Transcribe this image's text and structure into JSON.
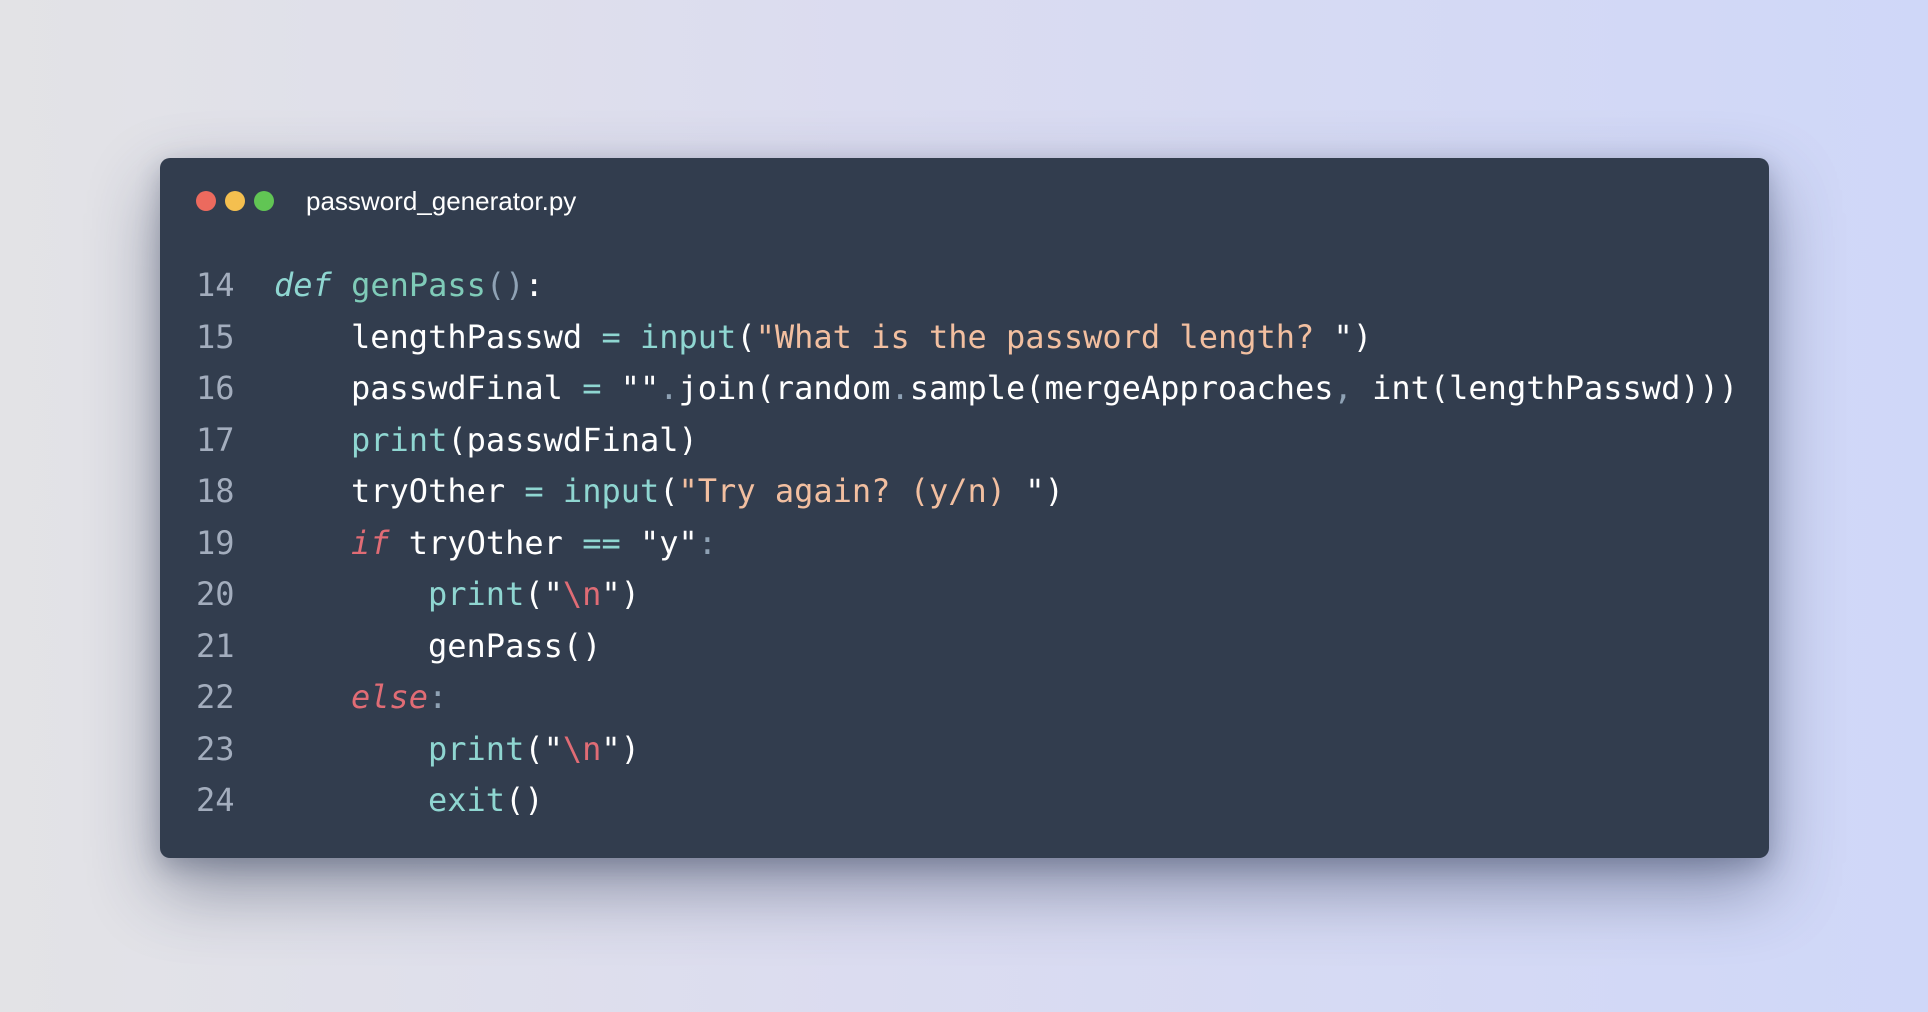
{
  "window": {
    "filename": "password_generator.py",
    "colors": {
      "background": "#323d4e",
      "close": "#ec6a5e",
      "minimize": "#f4bf4f",
      "maximize": "#61c554"
    }
  },
  "code": {
    "language": "python",
    "lines": [
      {
        "number": "14",
        "indent": 0,
        "tokens": [
          {
            "t": "def",
            "c": "def"
          },
          {
            "t": " ",
            "c": "id"
          },
          {
            "t": "genPass",
            "c": "fn"
          },
          {
            "t": "()",
            "c": "dim"
          },
          {
            "t": ":",
            "c": "id"
          }
        ]
      },
      {
        "number": "15",
        "indent": 1,
        "tokens": [
          {
            "t": "lengthPasswd",
            "c": "id"
          },
          {
            "t": " ",
            "c": "id"
          },
          {
            "t": "=",
            "c": "op"
          },
          {
            "t": " ",
            "c": "id"
          },
          {
            "t": "input",
            "c": "bi"
          },
          {
            "t": "(",
            "c": "id"
          },
          {
            "t": "\"What is the password length? ",
            "c": "str"
          },
          {
            "t": "\")",
            "c": "id"
          }
        ]
      },
      {
        "number": "16",
        "indent": 1,
        "tokens": [
          {
            "t": "passwdFinal",
            "c": "id"
          },
          {
            "t": " ",
            "c": "id"
          },
          {
            "t": "=",
            "c": "op"
          },
          {
            "t": " ",
            "c": "id"
          },
          {
            "t": "\"\"",
            "c": "id"
          },
          {
            "t": ".",
            "c": "dim"
          },
          {
            "t": "join(random",
            "c": "id"
          },
          {
            "t": ".",
            "c": "dim"
          },
          {
            "t": "sample(mergeApproaches",
            "c": "id"
          },
          {
            "t": ",",
            "c": "dim"
          },
          {
            "t": " int(lengthPasswd)))",
            "c": "id"
          }
        ]
      },
      {
        "number": "17",
        "indent": 1,
        "tokens": [
          {
            "t": "print",
            "c": "bi"
          },
          {
            "t": "(passwdFinal)",
            "c": "id"
          }
        ]
      },
      {
        "number": "18",
        "indent": 1,
        "tokens": [
          {
            "t": "tryOther",
            "c": "id"
          },
          {
            "t": " ",
            "c": "id"
          },
          {
            "t": "=",
            "c": "op"
          },
          {
            "t": " ",
            "c": "id"
          },
          {
            "t": "input",
            "c": "bi"
          },
          {
            "t": "(",
            "c": "id"
          },
          {
            "t": "\"Try again? (y/n) ",
            "c": "str"
          },
          {
            "t": "\")",
            "c": "id"
          }
        ]
      },
      {
        "number": "19",
        "indent": 1,
        "tokens": [
          {
            "t": "if",
            "c": "kw"
          },
          {
            "t": " tryOther ",
            "c": "id"
          },
          {
            "t": "==",
            "c": "op"
          },
          {
            "t": " ",
            "c": "id"
          },
          {
            "t": "\"y\"",
            "c": "id"
          },
          {
            "t": ":",
            "c": "dim"
          }
        ]
      },
      {
        "number": "20",
        "indent": 2,
        "tokens": [
          {
            "t": "print",
            "c": "bi"
          },
          {
            "t": "(\"",
            "c": "id"
          },
          {
            "t": "\\n",
            "c": "esc"
          },
          {
            "t": "\")",
            "c": "id"
          }
        ]
      },
      {
        "number": "21",
        "indent": 2,
        "tokens": [
          {
            "t": "genPass()",
            "c": "id"
          }
        ]
      },
      {
        "number": "22",
        "indent": 1,
        "tokens": [
          {
            "t": "else",
            "c": "kw"
          },
          {
            "t": ":",
            "c": "dim"
          }
        ]
      },
      {
        "number": "23",
        "indent": 2,
        "tokens": [
          {
            "t": "print",
            "c": "bi"
          },
          {
            "t": "(\"",
            "c": "id"
          },
          {
            "t": "\\n",
            "c": "esc"
          },
          {
            "t": "\")",
            "c": "id"
          }
        ]
      },
      {
        "number": "24",
        "indent": 2,
        "tokens": [
          {
            "t": "exit",
            "c": "bi"
          },
          {
            "t": "()",
            "c": "id"
          }
        ]
      }
    ]
  }
}
